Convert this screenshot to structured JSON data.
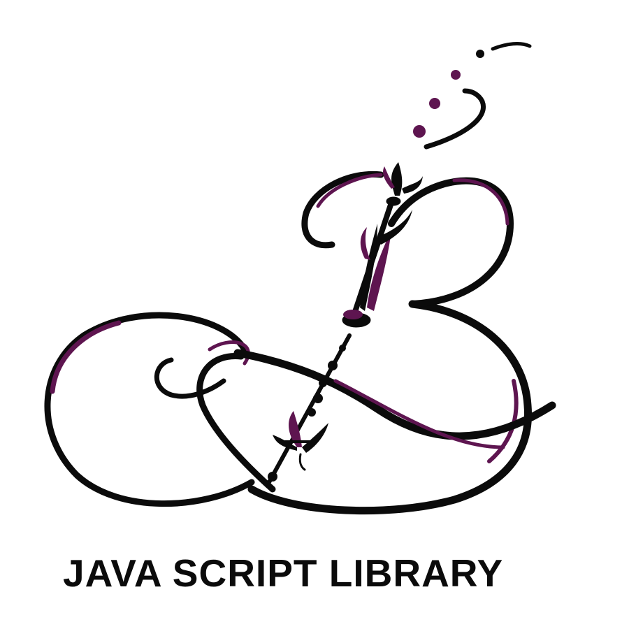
{
  "logo": {
    "icon": "calligraphic-b-monogram-icon",
    "colors": {
      "ink": "#0b0b0b",
      "accent": "#5e1550",
      "background": "#ffffff"
    }
  },
  "caption": {
    "text": "JAVA SCRIPT LIBRARY",
    "color": "#0b0b0b"
  }
}
